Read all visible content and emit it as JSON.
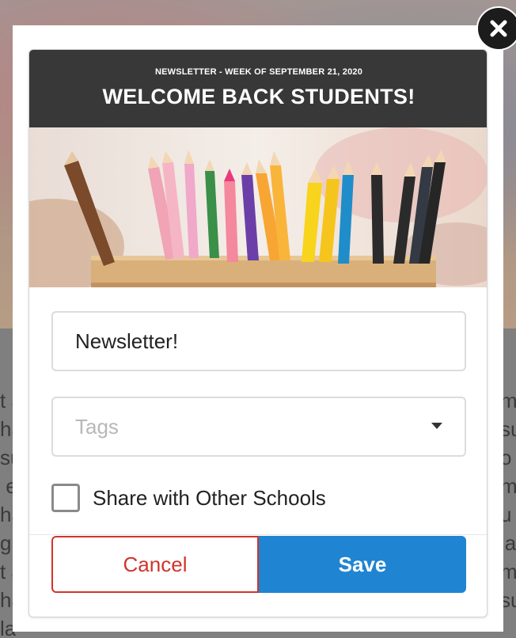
{
  "newsletter": {
    "kicker": "NEWSLETTER - WEEK OF SEPTEMBER 21, 2020",
    "title": "WELCOME BACK STUDENTS!",
    "banner_icon": "colored-pencils-image"
  },
  "form": {
    "name_value": "Newsletter!",
    "tags_placeholder": "Tags",
    "share_label": "Share with Other Schools",
    "share_checked": false
  },
  "actions": {
    "cancel_label": "Cancel",
    "save_label": "Save"
  },
  "colors": {
    "header_bg": "#383838",
    "cancel": "#d0342c",
    "save": "#1f84d2",
    "close_bg": "#1c1c1c"
  },
  "background": {
    "left_fragments": [
      "t a",
      "ha",
      "su",
      " e",
      "ha",
      "gr",
      "t a",
      "ha",
      "la"
    ],
    "right_fragments": [
      "m",
      "su",
      "o",
      "m",
      "u",
      "la",
      "m",
      "su"
    ]
  }
}
